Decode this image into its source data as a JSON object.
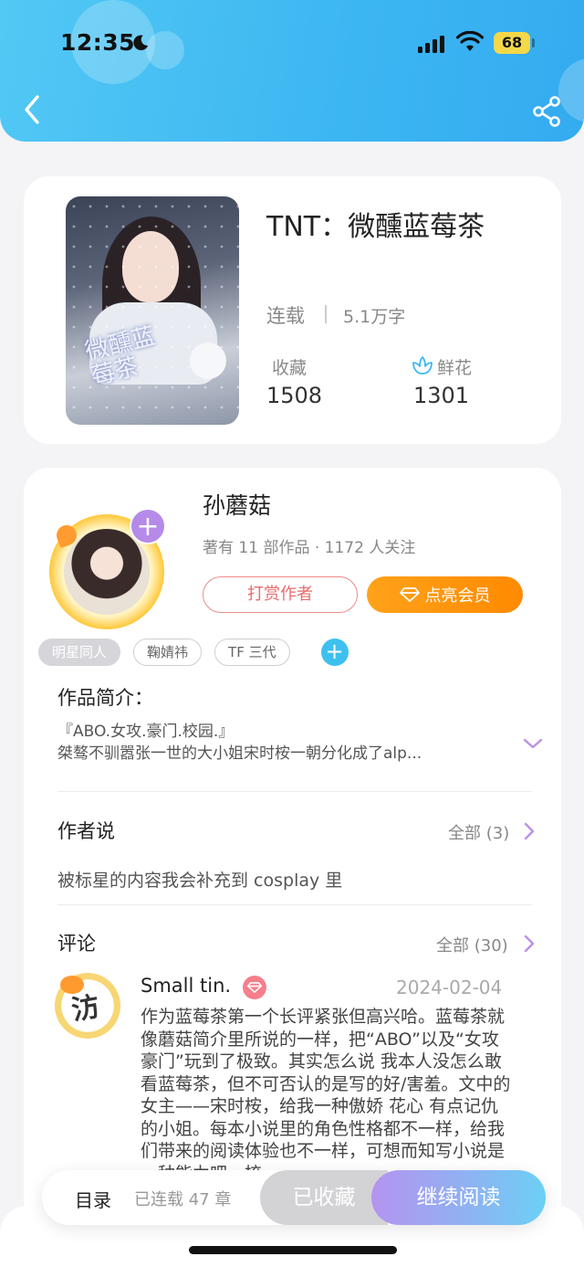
{
  "status_bar": {
    "time": "12:35",
    "battery": "68"
  },
  "book": {
    "title": "TNT：微醺蓝莓茶",
    "cover_title_art": "微醺蓝莓茶",
    "status": "连载",
    "word_count": "5.1万字",
    "favorites_label": "收藏",
    "favorites_count": "1508",
    "flowers_label": "鲜花",
    "flowers_count": "1301"
  },
  "author": {
    "name": "孙蘑菇",
    "meta": "著有 11 部作品 · 1172 人关注",
    "reward_label": "打赏作者",
    "vip_label": "点亮会员",
    "follow_symbol": "+"
  },
  "tags": [
    {
      "label": "明星同人"
    },
    {
      "label": "鞠婧祎"
    },
    {
      "label": "TF 三代"
    }
  ],
  "tag_add_symbol": "+",
  "intro": {
    "title": "作品简介：",
    "line1": "『ABO.女攻.豪门.校园.』",
    "line2": "桀骜不驯嚣张一世的大小姐宋时桉一朝分化成了alp..."
  },
  "author_says": {
    "title": "作者说",
    "all_label": "全部 (3)",
    "text": "被标星的内容我会补充到 cosplay 里"
  },
  "comments": {
    "title": "评论",
    "all_label": "全部 (30)",
    "items": [
      {
        "avatar_text": "汸",
        "user": "Small tin.",
        "date": "2024-02-04",
        "text": "作为蓝莓茶第一个长评紧张但高兴哈。蓝莓茶就像蘑菇简介里所说的一样，把“ABO”以及“女攻豪门”玩到了极致。其实怎么说 我本人没怎么敢看蓝莓茶，但不可否认的是写的好/害羞。文中的女主——宋时桉，给我一种傲娇 花心 有点记仇的小姐。每本小说里的角色性格都不一样，给我们带来的阅读体验也不一样，可想而知写小说是一种能力吧，梳"
      }
    ]
  },
  "bottom_bar": {
    "toc_label": "目录",
    "chapters_label": "已连载 47 章",
    "collected_label": "已收藏",
    "read_label": "继续阅读"
  },
  "icons": {
    "back": "chevron-left",
    "share": "share",
    "flower": "flower",
    "vip": "diamond",
    "expand": "chevron-down",
    "more": "chevron-right"
  },
  "colors": {
    "header": "#3cb6f2",
    "accent_purple": "#b58ae8",
    "vip_orange": "#ff8a00",
    "reward_red": "#e86c6c",
    "chevron": "#b892e6"
  }
}
